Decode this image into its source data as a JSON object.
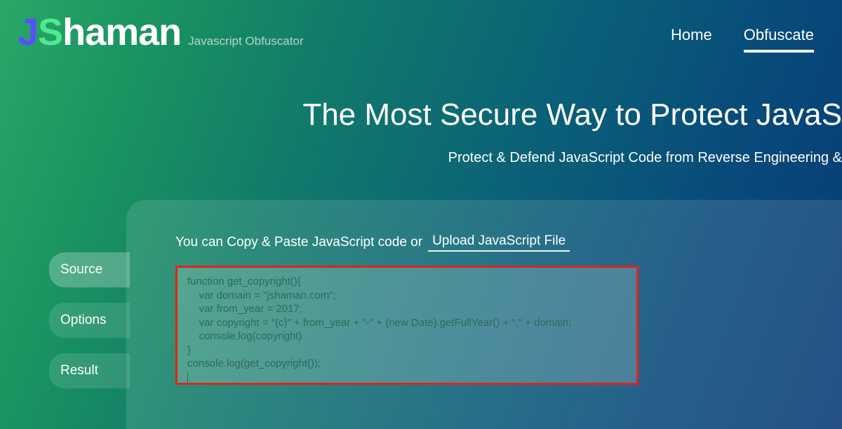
{
  "logo": {
    "j": "J",
    "s": "S",
    "rest": "haman",
    "tagline": "Javascript Obfuscator"
  },
  "nav": {
    "home": "Home",
    "obfuscate": "Obfuscate"
  },
  "hero": {
    "title": "The Most Secure Way to Protect JavaS",
    "sub": "Protect & Defend JavaScript Code from Reverse Engineering &"
  },
  "tabs": {
    "source": "Source",
    "options": "Options",
    "result": "Result"
  },
  "panel": {
    "prompt_prefix": "You can Copy & Paste JavaScript code or",
    "upload_label": "Upload JavaScript File"
  },
  "code": "function get_copyright(){\n    var domain = \"jshaman.com\";\n    var from_year = 2017;\n    var copyright = \"(c)\" + from_year + \"-\" + (new Date).getFullYear() + \",\" + domain;\n    console.log(copyright)\n}\nconsole.log(get_copyright());"
}
